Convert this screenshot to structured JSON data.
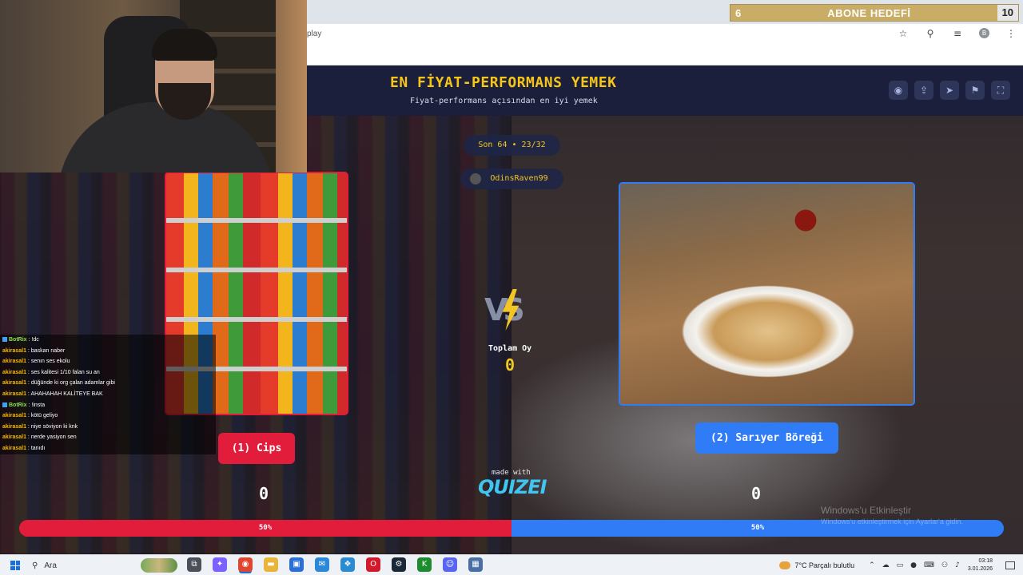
{
  "browser": {
    "url_fragment": "play",
    "subscriber_goal": {
      "current": "6",
      "title": "ABONE HEDEFİ",
      "target": "10"
    }
  },
  "game": {
    "title": "EN FİYAT-PERFORMANS YEMEK",
    "subtitle": "Fiyat-performans açısından en iyi yemek",
    "round": "Son 64 • 23/32",
    "author": "OdinsRaven99",
    "vs": "VS",
    "total_label": "Toplam Oy",
    "total_votes": "0",
    "left": {
      "label": "(1) Cips",
      "score": "0",
      "percent_text": "50%",
      "share": 0.5,
      "color": "#e21d3c"
    },
    "right": {
      "label": "(2) Sarıyer Böreği",
      "score": "0",
      "percent_text": "50%",
      "share": 0.5,
      "color": "#2f7cf6"
    },
    "made_with": "made with",
    "brand": "QUIZEI",
    "tools": [
      "eye-icon",
      "share-icon",
      "send-icon",
      "flag-icon",
      "fullscreen-icon"
    ]
  },
  "windows_activation": {
    "line1": "Windows'u Etkinleştir",
    "line2": "Windows'u etkinleştirmek için Ayarlar'a gidin."
  },
  "chat": [
    {
      "user": "BotRix",
      "msg": "!dc",
      "bot": true
    },
    {
      "user": "akirasal1",
      "msg": "baskan naber",
      "bot": false
    },
    {
      "user": "akirasal1",
      "msg": "senın ses ekolu",
      "bot": false
    },
    {
      "user": "akirasal1",
      "msg": "ses kalitesi 1/10 falan su an",
      "bot": false
    },
    {
      "user": "akirasal1",
      "msg": "düğünde ki org çalan adamlar gibi",
      "bot": false
    },
    {
      "user": "akirasal1",
      "msg": "AHAHAHAH KALİTEYE BAK",
      "bot": false
    },
    {
      "user": "BotRix",
      "msg": "!insta",
      "bot": true
    },
    {
      "user": "akirasal1",
      "msg": "kötü geliyo",
      "bot": false
    },
    {
      "user": "akirasal1",
      "msg": "niye söviyon ki knk",
      "bot": false
    },
    {
      "user": "akirasal1",
      "msg": "nerde yasiyon sen",
      "bot": false
    },
    {
      "user": "akirasal1",
      "msg": "tanıdı",
      "bot": false
    }
  ],
  "taskbar": {
    "search": "Ara",
    "apps": [
      {
        "name": "task-view-icon",
        "glyph": "⧉",
        "color": "#4a4f58"
      },
      {
        "name": "copilot-icon",
        "glyph": "✦",
        "color": "#7b61ff"
      },
      {
        "name": "chrome-icon",
        "glyph": "◉",
        "color": "#e0452f",
        "active": true
      },
      {
        "name": "folder-icon",
        "glyph": "▬",
        "color": "#e8b53a"
      },
      {
        "name": "store-icon",
        "glyph": "▣",
        "color": "#2b6fd6"
      },
      {
        "name": "mail-icon",
        "glyph": "✉",
        "color": "#2b88d8"
      },
      {
        "name": "photos-icon",
        "glyph": "❖",
        "color": "#2a8bd1"
      },
      {
        "name": "opera-icon",
        "glyph": "O",
        "color": "#d21a2c"
      },
      {
        "name": "steam-icon",
        "glyph": "⚙",
        "color": "#1b2838"
      },
      {
        "name": "kick-icon",
        "glyph": "K",
        "color": "#1e8c2e"
      },
      {
        "name": "discord-icon",
        "glyph": "☺",
        "color": "#5865f2"
      },
      {
        "name": "calculator-icon",
        "glyph": "▦",
        "color": "#4a6fa5"
      }
    ],
    "weather": "7°C  Parçalı bulutlu",
    "time": "03:18",
    "date": "3.01.2026"
  }
}
